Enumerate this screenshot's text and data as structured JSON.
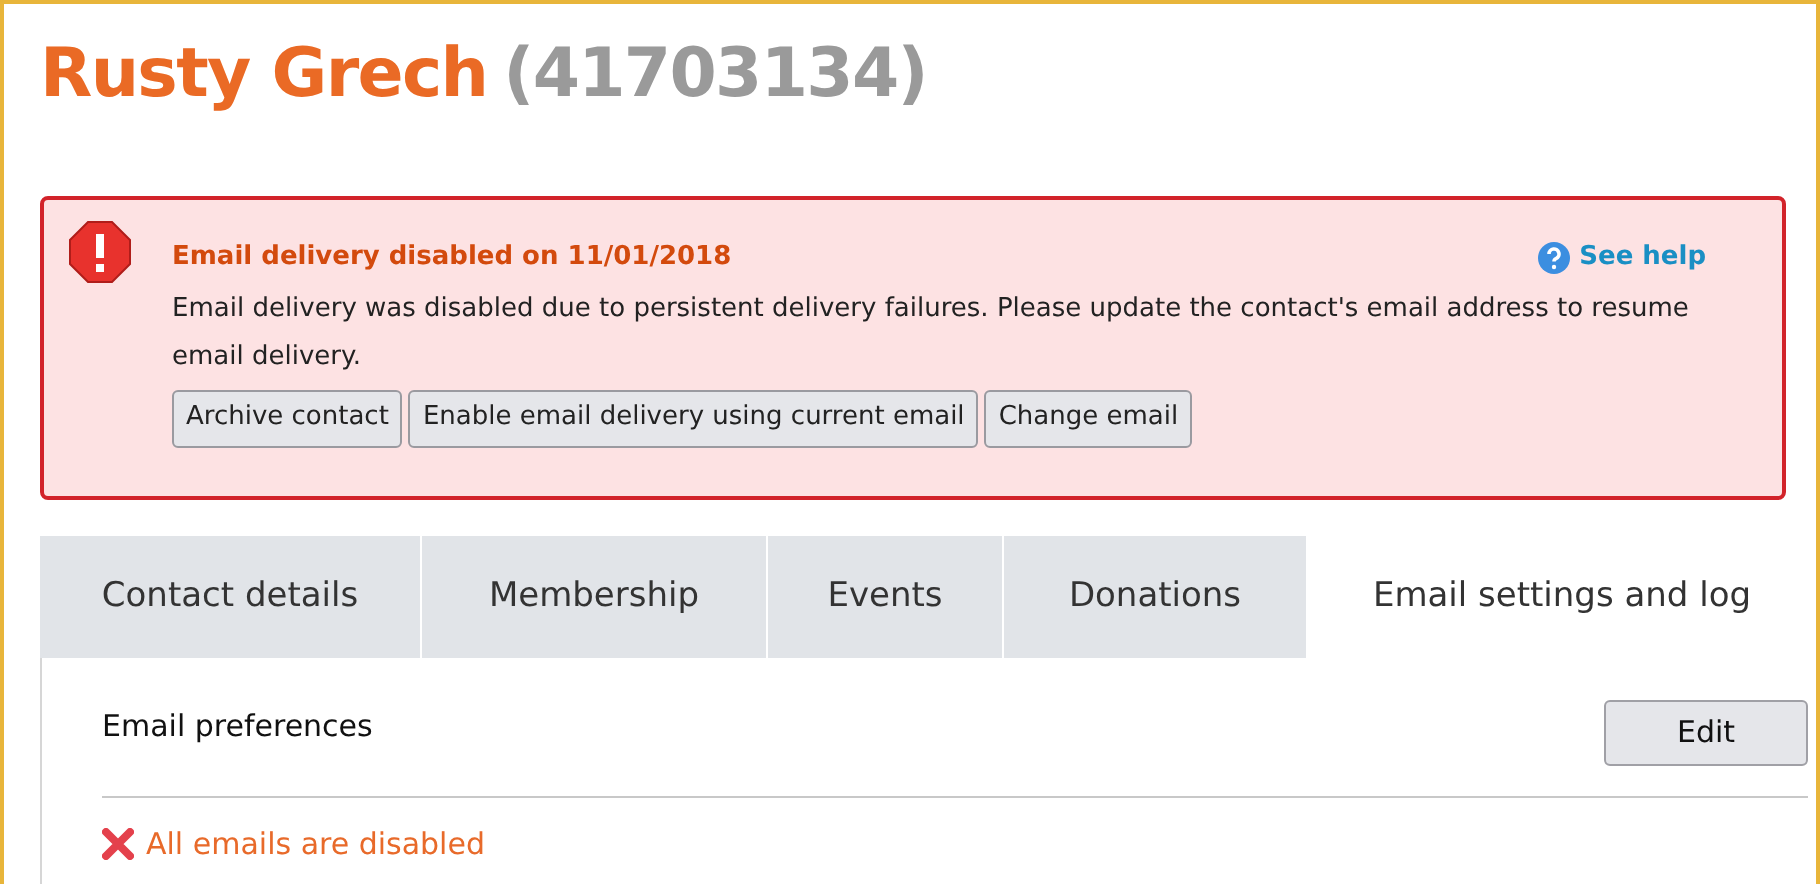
{
  "contact": {
    "name": "Rusty Grech",
    "id": "(41703134)"
  },
  "alert": {
    "title": "Email delivery disabled on 11/01/2018",
    "help": "See help",
    "message": "Email delivery was disabled due to persistent delivery failures. Please update the contact's email address to resume email delivery.",
    "buttons": [
      "Archive contact",
      "Enable email delivery using current email",
      "Change email"
    ]
  },
  "tabs": [
    {
      "label": "Contact details",
      "selected": false
    },
    {
      "label": "Membership",
      "selected": false
    },
    {
      "label": "Events",
      "selected": false
    },
    {
      "label": "Donations",
      "selected": false
    },
    {
      "label": "Email settings and log",
      "selected": true
    }
  ],
  "section": {
    "title": "Email preferences",
    "edit": "Edit",
    "status": "All emails are disabled"
  }
}
